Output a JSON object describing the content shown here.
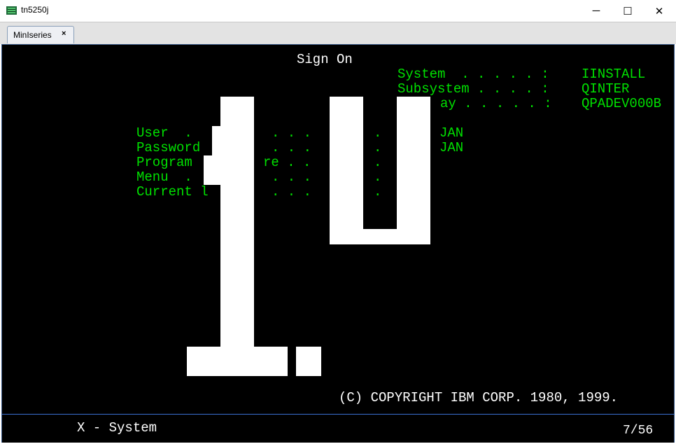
{
  "window": {
    "title": "tn5250j",
    "minimize_glyph": "─",
    "maximize_glyph": "☐",
    "close_glyph": "✕"
  },
  "tab": {
    "label": "MinIseries",
    "close_glyph": "×"
  },
  "screen": {
    "heading": "Sign On",
    "sys_info": [
      {
        "label": "System  . . . . . :",
        "value": "IINSTALL"
      },
      {
        "label": "Subsystem . . . . :",
        "value": "QINTER"
      },
      {
        "label": "ay . . . . . :",
        "value": "QPADEV000B"
      }
    ],
    "fields": [
      {
        "label": "User  .",
        "dots": ". . .",
        "tail": ".",
        "value": "JAN"
      },
      {
        "label": "Password",
        "dots": ". . .",
        "tail": ".",
        "value": "JAN"
      },
      {
        "label": "Program",
        "dots": "re . .",
        "tail": ".",
        "value": ""
      },
      {
        "label": "Menu  .",
        "dots": ". . .",
        "tail": ".",
        "value": ""
      },
      {
        "label": "Current l",
        "dots": ". . .",
        "tail": ".",
        "value": ""
      }
    ],
    "copyright": "(C) COPYRIGHT IBM CORP. 1980, 1999."
  },
  "status": {
    "message": "X - System",
    "cursor_position": "7/56"
  },
  "colors": {
    "terminal_bg": "#000000",
    "field_green": "#00e000",
    "text_white": "#ffffff",
    "status_divider": "#3a6fd0"
  }
}
